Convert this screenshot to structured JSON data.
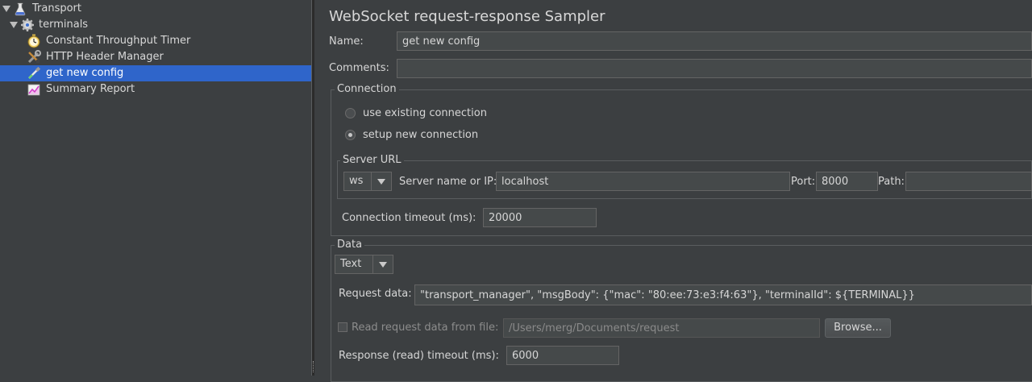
{
  "tree": {
    "items": [
      {
        "label": "Transport",
        "icon": "flask-icon"
      },
      {
        "label": "terminals",
        "icon": "gear-icon"
      },
      {
        "label": "Constant Throughput Timer",
        "icon": "stopwatch-icon"
      },
      {
        "label": "HTTP Header Manager",
        "icon": "wrench-icon"
      },
      {
        "label": "get new config",
        "icon": "pipette-icon"
      },
      {
        "label": "Summary Report",
        "icon": "chart-icon"
      }
    ]
  },
  "panel": {
    "title": "WebSocket request-response Sampler",
    "name_label": "Name:",
    "name_value": "get new config",
    "comments_label": "Comments:",
    "comments_value": "",
    "connection": {
      "legend": "Connection",
      "option_existing": "use existing connection",
      "option_new": "setup new connection",
      "selected": "setup new connection",
      "server_url": {
        "legend": "Server URL",
        "protocol": "ws",
        "server_label": "Server name or IP:",
        "server_value": "localhost",
        "port_label": "Port:",
        "port_value": "8000",
        "path_label": "Path:",
        "path_value": ""
      },
      "timeout_label": "Connection timeout (ms):",
      "timeout_value": "20000"
    },
    "data": {
      "legend": "Data",
      "type": "Text",
      "request_label": "Request data:",
      "request_value": "\"transport_manager\", \"msgBody\": {\"mac\": \"80:ee:73:e3:f4:63\"}, \"terminalId\": ${TERMINAL}}",
      "read_file_label": "Read request data from file:",
      "file_path": "/Users/merg/Documents/request",
      "browse_label": "Browse...",
      "response_timeout_label": "Response (read) timeout (ms):",
      "response_timeout_value": "6000"
    }
  }
}
